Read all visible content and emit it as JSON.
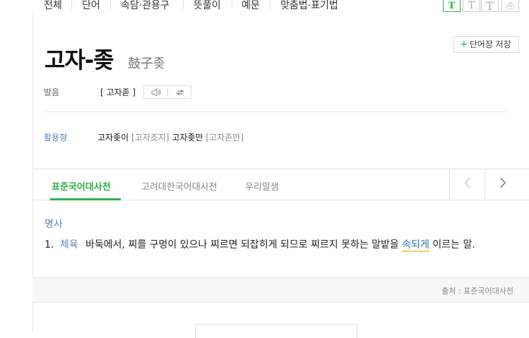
{
  "nav": {
    "items": [
      "전체",
      "단어",
      "속담·관용구",
      "뜻풀이",
      "예문",
      "맞춤법·표기법"
    ],
    "font_sizes": [
      "T",
      "T",
      "T"
    ],
    "print_glyph": "⎙"
  },
  "entry": {
    "headword": "고자-좆",
    "hanja": "鼓子좆",
    "save_label": "단어장 저장",
    "pron_label": "발음",
    "pron_value": "[ 고자졷 ]",
    "conj_label": "활용형",
    "conj": [
      "고자좆이",
      "[고자조지]",
      "고자좆만",
      "[고자존만]"
    ]
  },
  "tabs": [
    "표준국어대사전",
    "고려대한국어대사전",
    "우리말샘"
  ],
  "definition": {
    "pos": "명사",
    "number": "1.",
    "category": "체육",
    "text_before": "바둑에서, 찌를 구멍이 있으나 찌르면 되잡히게 되므로 찌르지 못하는 말밭을",
    "link": "속되게",
    "text_after": "이르는 말."
  },
  "source": "출처 : 표준국어대사전",
  "colors": {
    "accent": "#2cb24a",
    "category": "#5b86b0",
    "link": "#2d6cc0"
  }
}
